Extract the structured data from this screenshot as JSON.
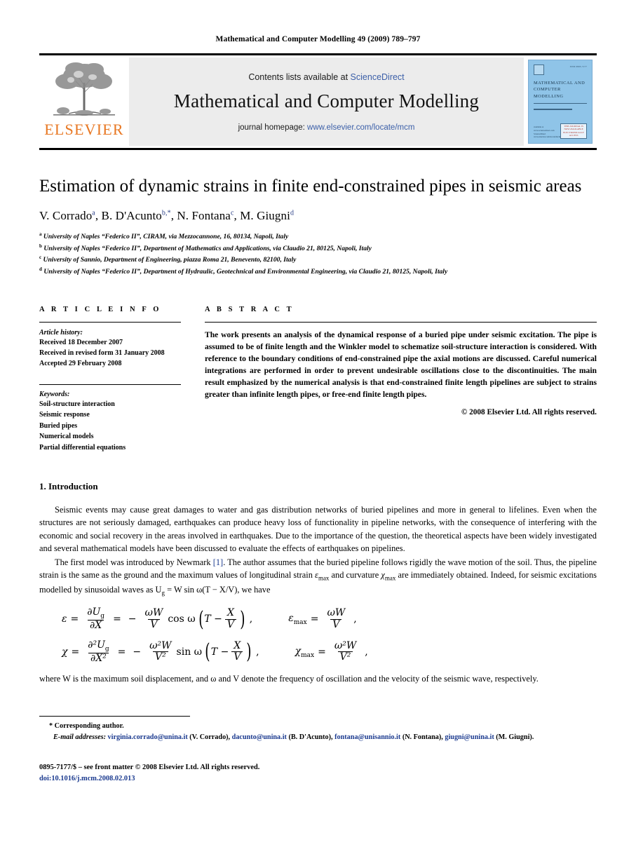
{
  "running_head": "Mathematical and Computer Modelling 49 (2009) 789–797",
  "header": {
    "publisher": "ELSEVIER",
    "contents_prefix": "Contents lists available at ",
    "contents_link": "ScienceDirect",
    "journal_title": "Mathematical and Computer Modelling",
    "homepage_prefix": "journal homepage: ",
    "homepage_link": "www.elsevier.com/locate/mcm",
    "cover": {
      "title": "MATHEMATICAL AND COMPUTER MODELLING",
      "issn": "ISSN 0895-7177",
      "sciencedirect": "available at www.sciencedirect.com ScienceDirect www.elsevier.com/locate/mcm",
      "badge": "THIS JOURNAL IS NOW AVAILABLE ELECTRONICALLY ACCESS"
    }
  },
  "article": {
    "title": "Estimation of dynamic strains in finite end-constrained pipes in seismic areas",
    "authors": "V. Corrado a, B. D'Acunto b,*, N. Fontana c, M. Giugni d",
    "author_parts": [
      {
        "name": "V. Corrado",
        "sup": "a"
      },
      {
        "name": "B. D'Acunto",
        "sup": "b,*"
      },
      {
        "name": "N. Fontana",
        "sup": "c"
      },
      {
        "name": "M. Giugni",
        "sup": "d"
      }
    ],
    "affiliations": [
      {
        "mark": "a",
        "text": "University of Naples “Federico II”, CIRAM, via Mezzocannone, 16, 80134, Napoli, Italy"
      },
      {
        "mark": "b",
        "text": "University of Naples “Federico II”, Department of Mathematics and Applications, via Claudio 21, 80125, Napoli, Italy"
      },
      {
        "mark": "c",
        "text": "University of Sannio, Department of Engineering, piazza Roma 21, Benevento, 82100, Italy"
      },
      {
        "mark": "d",
        "text": "University of Naples “Federico II”, Department of Hydraulic, Geotechnical and Environmental Engineering, via Claudio 21, 80125, Napoli, Italy"
      }
    ]
  },
  "article_info": {
    "heading": "A R T I C L E    I N F O",
    "history_label": "Article history:",
    "history": [
      "Received 18 December 2007",
      "Received in revised form 31 January 2008",
      "Accepted 29 February 2008"
    ],
    "keywords_label": "Keywords:",
    "keywords": [
      "Soil-structure interaction",
      "Seismic response",
      "Buried pipes",
      "Numerical models",
      "Partial differential equations"
    ]
  },
  "abstract": {
    "heading": "A B S T R A C T",
    "text": "The work presents an analysis of the dynamical response of a buried pipe under seismic excitation. The pipe is assumed to be of finite length and the Winkler model to schematize soil-structure interaction is considered. With reference to the boundary conditions of end-constrained pipe the axial motions are discussed. Careful numerical integrations are performed in order to prevent undesirable oscillations close to the discontinuities. The main result emphasized by the numerical analysis is that end-constrained finite length pipelines are subject to strains greater than infinite length pipes, or free-end finite length pipes.",
    "copyright": "© 2008 Elsevier Ltd. All rights reserved."
  },
  "body": {
    "section_number_title": "1. Introduction",
    "paragraph1": "Seismic events may cause great damages to water and gas distribution networks of buried pipelines and more in general to lifelines. Even when the structures are not seriously damaged, earthquakes can produce heavy loss of functionality in pipeline networks, with the consequence of interfering with the economic and social recovery in the areas involved in earthquakes. Due to the importance of the question, the theoretical aspects have been widely investigated and several mathematical models have been discussed to evaluate the effects of earthquakes on pipelines.",
    "paragraph2_a": "The first model was introduced by Newmark ",
    "paragraph2_cite": "[1]",
    "paragraph2_b": ". The author assumes that the buried pipeline follows rigidly the wave motion of the soil. Thus, the pipeline strain is the same as the ground and the maximum values of longitudinal strain ",
    "paragraph2_c": " and curvature ",
    "paragraph2_d": " are immediately obtained. Indeed, for seismic excitations modelled by sinusoidal waves as U",
    "paragraph2_e": " = W sin ω(T − X/V), we have",
    "paragraph3": "where W is the maximum soil displacement, and ω and V denote the frequency of oscillation and the velocity of the seismic wave, respectively."
  },
  "equations": {
    "eq1": {
      "lhs": "ε",
      "d_num": "∂U",
      "d_num_sub": "g",
      "d_den": "∂X",
      "coef_num": "ωW",
      "coef_den": "V",
      "fn": "cos ω",
      "inner": "T −",
      "inner_num": "X",
      "inner_den": "V",
      "max_lhs": "ε",
      "max_sub": "max",
      "max_num": "ωW",
      "max_den": "V"
    },
    "eq2": {
      "lhs": "χ",
      "d_num": "∂²U",
      "d_num_sub": "g",
      "d_den": "∂X²",
      "coef_num": "ω²W",
      "coef_den": "V²",
      "fn": "sin ω",
      "inner": "T −",
      "inner_num": "X",
      "inner_den": "V",
      "max_lhs": "χ",
      "max_sub": "max",
      "max_num": "ω²W",
      "max_den": "V²"
    }
  },
  "footnotes": {
    "corresponding": "* Corresponding author.",
    "email_label": "E-mail addresses:",
    "emails": [
      {
        "address": "virginia.corrado@unina.it",
        "owner": "(V. Corrado),"
      },
      {
        "address": "dacunto@unina.it",
        "owner": "(B. D'Acunto),"
      },
      {
        "address": "fontana@unisannio.it",
        "owner": "(N. Fontana),"
      },
      {
        "address": "giugni@unina.it",
        "owner": "(M. Giugni)."
      }
    ]
  },
  "footer": {
    "front_matter": "0895-7177/$ – see front matter © 2008 Elsevier Ltd. All rights reserved.",
    "doi": "doi:10.1016/j.mcm.2008.02.013"
  }
}
